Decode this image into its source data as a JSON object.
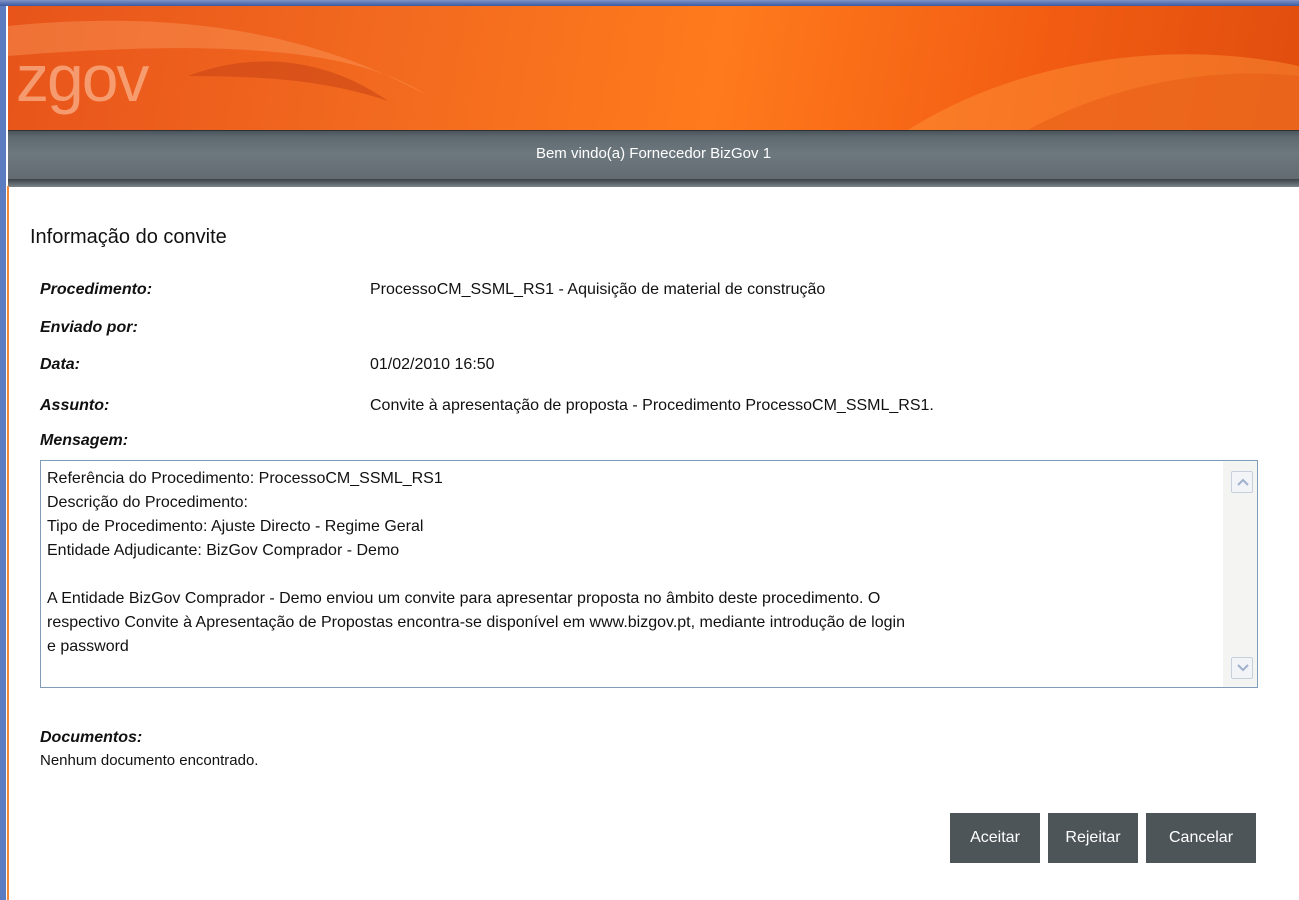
{
  "banner": {
    "logo_text": "zgov"
  },
  "header": {
    "welcome": "Bem vindo(a) Fornecedor BizGov 1"
  },
  "invitation": {
    "title": "Informação do convite",
    "fields": {
      "procedure_label": "Procedimento:",
      "procedure_value": "ProcessoCM_SSML_RS1 - Aquisição de material de construção",
      "sent_by_label": "Enviado por:",
      "sent_by_value": "",
      "date_label": "Data:",
      "date_value": "01/02/2010 16:50",
      "subject_label": "Assunto:",
      "subject_value": "Convite à apresentação de proposta - Procedimento ProcessoCM_SSML_RS1."
    },
    "message_label": "Mensagem:",
    "message_lines": [
      "Referência do Procedimento: ProcessoCM_SSML_RS1",
      "Descrição do Procedimento:",
      "Tipo de Procedimento: Ajuste Directo - Regime Geral",
      "Entidade Adjudicante: BizGov Comprador - Demo",
      "",
      "A Entidade BizGov Comprador - Demo enviou um convite para apresentar proposta no âmbito deste procedimento. O",
      "respectivo Convite à Apresentação de Propostas encontra-se disponível em www.bizgov.pt, mediante introdução de login",
      "e password"
    ],
    "documents_label": "Documentos:",
    "documents_empty": "Nenhum documento encontrado."
  },
  "actions": {
    "accept_label": "Aceitar",
    "reject_label": "Rejeitar",
    "cancel_label": "Cancelar"
  },
  "colors": {
    "banner_orange": "#f26a1f",
    "bar_gray": "#6d787e",
    "button_bg": "#4d5559"
  }
}
